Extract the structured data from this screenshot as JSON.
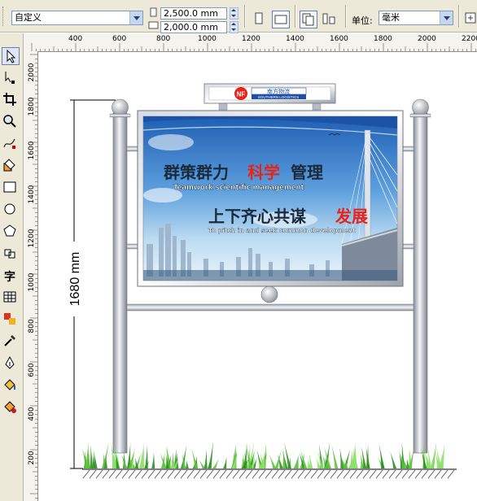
{
  "property_bar": {
    "paper_preset": "自定义",
    "width_value": "2,500.0 mm",
    "height_value": "2,000.0 mm",
    "units_label": "单位:",
    "units_value": "毫米"
  },
  "rulers": {
    "horizontal_ticks": [
      "400",
      "600",
      "800",
      "1000",
      "1200",
      "1400",
      "1600",
      "1800",
      "2000",
      "2200"
    ],
    "vertical_ticks": [
      "2000",
      "1800",
      "1600",
      "1400",
      "1200",
      "1000",
      "800",
      "600",
      "400",
      "200"
    ]
  },
  "toolbox": {
    "tools": [
      "pick-tool",
      "shape-tool",
      "crop-tool",
      "zoom-tool",
      "freehand-tool",
      "smart-fill-tool",
      "rectangle-tool",
      "ellipse-tool",
      "polygon-tool",
      "basic-shapes-tool",
      "text-tool",
      "table-tool",
      "interactive-blend-tool",
      "eyedropper-tool",
      "outline-tool",
      "fill-tool",
      "interactive-fill-tool"
    ],
    "text_tool_glyph": "字"
  },
  "drawing": {
    "dimension_label": "1680 mm",
    "company_name_cn": "南方物流",
    "company_name_en": "SOUTHERN LOGISTICS",
    "logo_letters": "NF",
    "headline_1_part_a": "群策群力",
    "headline_1_part_b": "科学",
    "headline_1_part_c": "管理",
    "subline_1": "Teamwork scientific management",
    "headline_2_part_a": "上下齐心共谋",
    "headline_2_part_b": "发展",
    "subline_2": "To pitch in and seek common development",
    "colors": {
      "accent_red": "#e8231a",
      "sky_blue": "#2a78c8",
      "pole_gray": "#c8ccd4",
      "grass_green": "#3aa52a"
    }
  }
}
